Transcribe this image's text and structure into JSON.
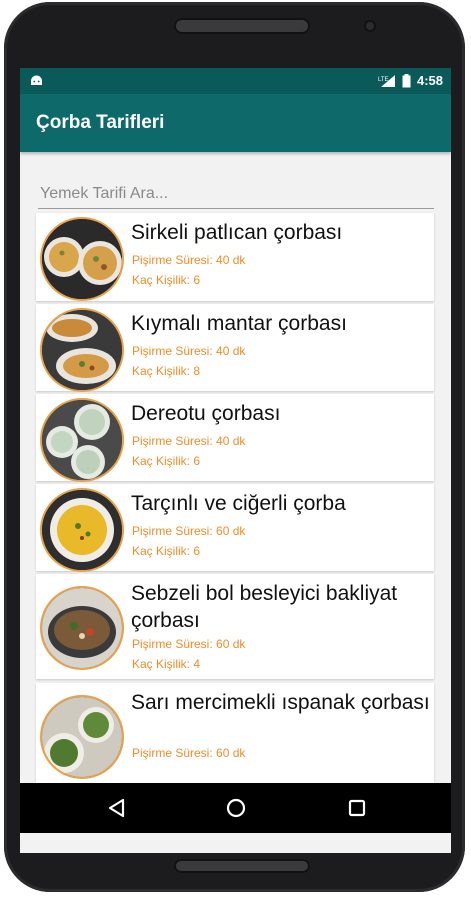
{
  "status_bar": {
    "time": "4:58",
    "network_label": "LTE"
  },
  "app_bar": {
    "title": "Çorba Tarifleri"
  },
  "search": {
    "placeholder": "Yemek Tarifi Ara..."
  },
  "recipes": [
    {
      "name": "Sirkeli patlıcan çorbası",
      "cook_time": "Pişirme Süresi: 40 dk",
      "servings": "Kaç Kişilik: 6"
    },
    {
      "name": "Kıymalı mantar çorbası",
      "cook_time": "Pişirme Süresi: 40 dk",
      "servings": "Kaç Kişilik: 8"
    },
    {
      "name": "Dereotu çorbası",
      "cook_time": "Pişirme Süresi: 40 dk",
      "servings": "Kaç Kişilik: 6"
    },
    {
      "name": "Tarçınlı ve ciğerli çorba",
      "cook_time": "Pişirme Süresi: 60 dk",
      "servings": "Kaç Kişilik: 6"
    },
    {
      "name": "Sebzeli bol besleyici bakliyat çorbası",
      "cook_time": "Pişirme Süresi: 60 dk",
      "servings": "Kaç Kişilik: 4"
    },
    {
      "name": "Sarı mercimekli ıspanak çorbası",
      "cook_time": "Pişirme Süresi: 60 dk",
      "servings": ""
    }
  ],
  "colors": {
    "app_bar": "#0e6a6a",
    "status_bar": "#0b5a5a",
    "meta_text": "#f28c28"
  },
  "nav": {
    "back_icon": "back-triangle-icon",
    "home_icon": "home-circle-icon",
    "recents_icon": "recents-square-icon"
  }
}
